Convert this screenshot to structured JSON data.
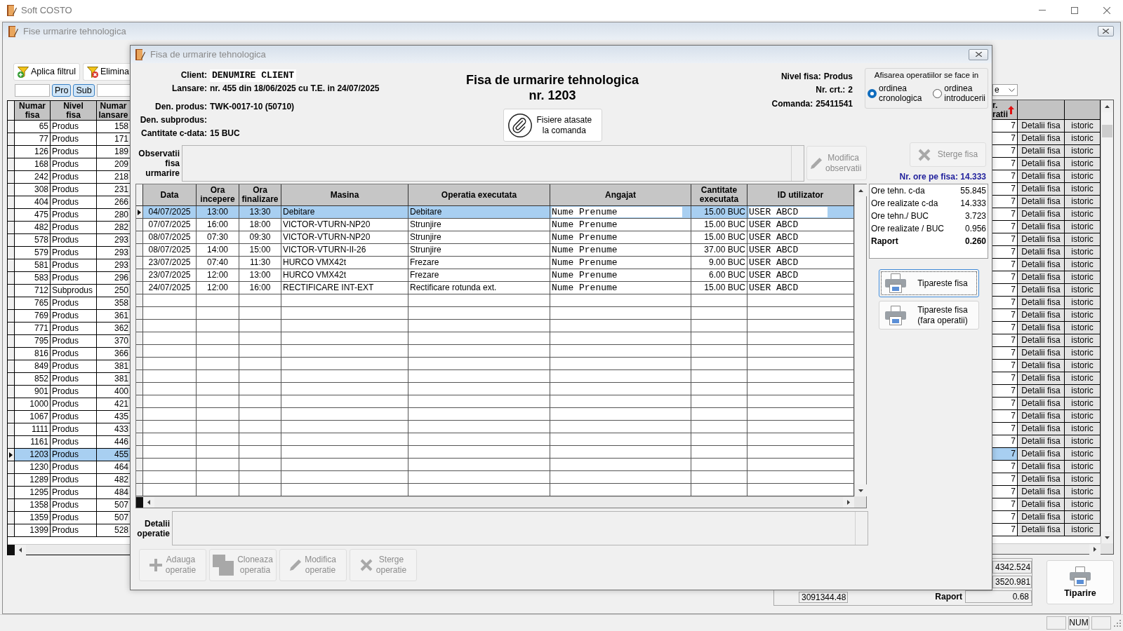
{
  "app_window": {
    "title": "Soft COSTO"
  },
  "child_window": {
    "title": "Fise urmarire tehnologica"
  },
  "filter_toolbar": [
    {
      "kind": "apply",
      "label": "Aplica filtrul"
    },
    {
      "kind": "remove",
      "label": "Elimina"
    }
  ],
  "filter_toggles": [
    {
      "label": "Pro",
      "selected": true
    },
    {
      "label": "Sub",
      "selected": true
    }
  ],
  "column_filter": {
    "value": "e"
  },
  "sheets_table": {
    "columns": [
      "Numar\nfisa",
      "Nivel\nfisa",
      "Numar\nlansare"
    ],
    "column_4": {
      "label": "r.\nratii",
      "sorted": true
    },
    "rows": [
      {
        "numar_fisa": "65",
        "nivel_fisa": "Produs",
        "numar_lansare": "158",
        "column_4": "7",
        "column_5": "Detalii fisa",
        "column_6": "istoric",
        "selected": false
      },
      {
        "numar_fisa": "77",
        "nivel_fisa": "Produs",
        "numar_lansare": "171",
        "column_4": "7",
        "column_5": "Detalii fisa",
        "column_6": "istoric",
        "selected": false
      },
      {
        "numar_fisa": "126",
        "nivel_fisa": "Produs",
        "numar_lansare": "189",
        "column_4": "7",
        "column_5": "Detalii fisa",
        "column_6": "istoric",
        "selected": false
      },
      {
        "numar_fisa": "168",
        "nivel_fisa": "Produs",
        "numar_lansare": "209",
        "column_4": "7",
        "column_5": "Detalii fisa",
        "column_6": "istoric",
        "selected": false
      },
      {
        "numar_fisa": "242",
        "nivel_fisa": "Produs",
        "numar_lansare": "218",
        "column_4": "7",
        "column_5": "Detalii fisa",
        "column_6": "istoric",
        "selected": false
      },
      {
        "numar_fisa": "308",
        "nivel_fisa": "Produs",
        "numar_lansare": "231",
        "column_4": "7",
        "column_5": "Detalii fisa",
        "column_6": "istoric",
        "selected": false
      },
      {
        "numar_fisa": "404",
        "nivel_fisa": "Produs",
        "numar_lansare": "266",
        "column_4": "7",
        "column_5": "Detalii fisa",
        "column_6": "istoric",
        "selected": false
      },
      {
        "numar_fisa": "475",
        "nivel_fisa": "Produs",
        "numar_lansare": "280",
        "column_4": "7",
        "column_5": "Detalii fisa",
        "column_6": "istoric",
        "selected": false
      },
      {
        "numar_fisa": "482",
        "nivel_fisa": "Produs",
        "numar_lansare": "282",
        "column_4": "7",
        "column_5": "Detalii fisa",
        "column_6": "istoric",
        "selected": false
      },
      {
        "numar_fisa": "578",
        "nivel_fisa": "Produs",
        "numar_lansare": "293",
        "column_4": "7",
        "column_5": "Detalii fisa",
        "column_6": "istoric",
        "selected": false
      },
      {
        "numar_fisa": "579",
        "nivel_fisa": "Produs",
        "numar_lansare": "293",
        "column_4": "7",
        "column_5": "Detalii fisa",
        "column_6": "istoric",
        "selected": false
      },
      {
        "numar_fisa": "581",
        "nivel_fisa": "Produs",
        "numar_lansare": "293",
        "column_4": "7",
        "column_5": "Detalii fisa",
        "column_6": "istoric",
        "selected": false
      },
      {
        "numar_fisa": "583",
        "nivel_fisa": "Produs",
        "numar_lansare": "296",
        "column_4": "7",
        "column_5": "Detalii fisa",
        "column_6": "istoric",
        "selected": false
      },
      {
        "numar_fisa": "712",
        "nivel_fisa": "Subprodus",
        "numar_lansare": "250",
        "column_4": "7",
        "column_5": "Detalii fisa",
        "column_6": "istoric",
        "selected": false
      },
      {
        "numar_fisa": "765",
        "nivel_fisa": "Produs",
        "numar_lansare": "358",
        "column_4": "7",
        "column_5": "Detalii fisa",
        "column_6": "istoric",
        "selected": false
      },
      {
        "numar_fisa": "769",
        "nivel_fisa": "Produs",
        "numar_lansare": "361",
        "column_4": "7",
        "column_5": "Detalii fisa",
        "column_6": "istoric",
        "selected": false
      },
      {
        "numar_fisa": "771",
        "nivel_fisa": "Produs",
        "numar_lansare": "362",
        "column_4": "7",
        "column_5": "Detalii fisa",
        "column_6": "istoric",
        "selected": false
      },
      {
        "numar_fisa": "795",
        "nivel_fisa": "Produs",
        "numar_lansare": "370",
        "column_4": "7",
        "column_5": "Detalii fisa",
        "column_6": "istoric",
        "selected": false
      },
      {
        "numar_fisa": "816",
        "nivel_fisa": "Produs",
        "numar_lansare": "366",
        "column_4": "7",
        "column_5": "Detalii fisa",
        "column_6": "istoric",
        "selected": false
      },
      {
        "numar_fisa": "849",
        "nivel_fisa": "Produs",
        "numar_lansare": "381",
        "column_4": "7",
        "column_5": "Detalii fisa",
        "column_6": "istoric",
        "selected": false
      },
      {
        "numar_fisa": "852",
        "nivel_fisa": "Produs",
        "numar_lansare": "381",
        "column_4": "7",
        "column_5": "Detalii fisa",
        "column_6": "istoric",
        "selected": false
      },
      {
        "numar_fisa": "901",
        "nivel_fisa": "Produs",
        "numar_lansare": "400",
        "column_4": "7",
        "column_5": "Detalii fisa",
        "column_6": "istoric",
        "selected": false
      },
      {
        "numar_fisa": "1000",
        "nivel_fisa": "Produs",
        "numar_lansare": "421",
        "column_4": "7",
        "column_5": "Detalii fisa",
        "column_6": "istoric",
        "selected": false
      },
      {
        "numar_fisa": "1067",
        "nivel_fisa": "Produs",
        "numar_lansare": "435",
        "column_4": "7",
        "column_5": "Detalii fisa",
        "column_6": "istoric",
        "selected": false
      },
      {
        "numar_fisa": "1111",
        "nivel_fisa": "Produs",
        "numar_lansare": "433",
        "column_4": "7",
        "column_5": "Detalii fisa",
        "column_6": "istoric",
        "selected": false
      },
      {
        "numar_fisa": "1161",
        "nivel_fisa": "Produs",
        "numar_lansare": "446",
        "column_4": "7",
        "column_5": "Detalii fisa",
        "column_6": "istoric",
        "selected": false
      },
      {
        "numar_fisa": "1203",
        "nivel_fisa": "Produs",
        "numar_lansare": "455",
        "column_4": "7",
        "column_5": "Detalii fisa",
        "column_6": "istoric",
        "selected": true
      },
      {
        "numar_fisa": "1230",
        "nivel_fisa": "Produs",
        "numar_lansare": "464",
        "column_4": "7",
        "column_5": "Detalii fisa",
        "column_6": "istoric",
        "selected": false
      },
      {
        "numar_fisa": "1289",
        "nivel_fisa": "Produs",
        "numar_lansare": "482",
        "column_4": "7",
        "column_5": "Detalii fisa",
        "column_6": "istoric",
        "selected": false
      },
      {
        "numar_fisa": "1295",
        "nivel_fisa": "Produs",
        "numar_lansare": "484",
        "column_4": "7",
        "column_5": "Detalii fisa",
        "column_6": "istoric",
        "selected": false
      },
      {
        "numar_fisa": "1358",
        "nivel_fisa": "Produs",
        "numar_lansare": "507",
        "column_4": "7",
        "column_5": "Detalii fisa",
        "column_6": "istoric",
        "selected": false
      },
      {
        "numar_fisa": "1359",
        "nivel_fisa": "Produs",
        "numar_lansare": "507",
        "column_4": "7",
        "column_5": "Detalii fisa",
        "column_6": "istoric",
        "selected": false
      },
      {
        "numar_fisa": "1399",
        "nivel_fisa": "Produs",
        "numar_lansare": "528",
        "column_4": "7",
        "column_5": "Detalii fisa",
        "column_6": "istoric",
        "selected": false
      }
    ]
  },
  "dialog": {
    "title": "Fisa de urmarire tehnologica",
    "client_fields": [
      {
        "label": "Client:",
        "value": "DENUMIRE CLIENT",
        "kind": "boxed"
      },
      {
        "label": "Lansare:",
        "value": "nr. 455 din 18/06/2025 cu T.E. in 24/07/2025",
        "kind": "plain"
      }
    ],
    "product_fields": [
      {
        "label": "Den. produs:",
        "value": "TWK-0017-10 (50710)",
        "kind": "plain"
      },
      {
        "label": "Den. subprodus:"
      },
      {
        "label": "Cantitate c-data:",
        "value": "15 BUC",
        "kind": "plain"
      }
    ],
    "heading": {
      "title": "Fisa de urmarire tehnologica",
      "number": "nr. 1203"
    },
    "attachments_button": {
      "label": "Fisiere atasate\nla comanda"
    },
    "info_right": [
      {
        "label": "Nivel fisa:",
        "value": "Produs"
      },
      {
        "label": "Nr. crt.:",
        "value": "2"
      },
      {
        "label": "Comanda:",
        "value": "25411541"
      }
    ],
    "order_group": {
      "title": "Afisarea operatiilor se face in",
      "options": [
        {
          "label": "ordinea\ncronologica",
          "selected": true
        },
        {
          "label": "ordinea\nintroducerii",
          "selected": false
        }
      ]
    },
    "notes": {
      "label": "Observatii\nfisa\nurmarire"
    },
    "edit_notes_button": {
      "label": "Modifica\nobservatii",
      "disabled": true
    },
    "delete_button": {
      "label": "Sterge fisa",
      "disabled": true
    },
    "hours_total": "Nr. ore pe fisa: 14.333",
    "operations": {
      "columns": [
        "Data",
        "Ora\nincepere",
        "Ora\nfinalizare",
        "Masina",
        "Operatia executata",
        "Angajat",
        "Cantitate\nexecutata",
        "ID utilizator"
      ],
      "rows": [
        {
          "date": "04/07/2025",
          "start_time": "13:00",
          "end_time": "13:30",
          "machine": "Debitare",
          "operation": "Debitare",
          "employee": "Nume Prenume",
          "quantity": "15.00 BUC",
          "user_id": "USER ABCD",
          "selected": true
        },
        {
          "date": "07/07/2025",
          "start_time": "16:00",
          "end_time": "18:00",
          "machine": "VICTOR-VTURN-NP20",
          "operation": "Strunjire",
          "employee": "Nume Prenume",
          "quantity": "15.00 BUC",
          "user_id": "USER ABCD",
          "selected": false
        },
        {
          "date": "08/07/2025",
          "start_time": "07:30",
          "end_time": "09:30",
          "machine": "VICTOR-VTURN-NP20",
          "operation": "Strunjire",
          "employee": "Nume Prenume",
          "quantity": "15.00 BUC",
          "user_id": "USER ABCD",
          "selected": false
        },
        {
          "date": "08/07/2025",
          "start_time": "14:00",
          "end_time": "15:00",
          "machine": "VICTOR-VTURN-II-26",
          "operation": "Strunjire",
          "employee": "Nume Prenume",
          "quantity": "37.00 BUC",
          "user_id": "USER ABCD",
          "selected": false
        },
        {
          "date": "23/07/2025",
          "start_time": "07:40",
          "end_time": "11:30",
          "machine": "HURCO VMX42t",
          "operation": "Frezare",
          "employee": "Nume Prenume",
          "quantity": "9.00 BUC",
          "user_id": "USER ABCD",
          "selected": false
        },
        {
          "date": "23/07/2025",
          "start_time": "12:00",
          "end_time": "13:00",
          "machine": "HURCO VMX42t",
          "operation": "Frezare",
          "employee": "Nume Prenume",
          "quantity": "6.00 BUC",
          "user_id": "USER ABCD",
          "selected": false
        },
        {
          "date": "24/07/2025",
          "start_time": "12:00",
          "end_time": "16:00",
          "machine": "RECTIFICARE INT-EXT",
          "operation": "Rectificare rotunda ext.",
          "employee": "Nume Prenume",
          "quantity": "15.00 BUC",
          "user_id": "USER ABCD",
          "selected": false
        }
      ]
    },
    "stats": [
      {
        "label": "Ore tehn. c-da",
        "value": "55.845",
        "kind": "normal"
      },
      {
        "label": "Ore realizate c-da",
        "value": "14.333",
        "kind": "normal"
      },
      {
        "label": "Ore tehn./ BUC",
        "value": "3.723",
        "kind": "normal"
      },
      {
        "label": "Ore realizate / BUC",
        "value": "0.956",
        "kind": "normal"
      },
      {
        "label": "Raport",
        "value": "0.260",
        "kind": "total"
      }
    ],
    "print_buttons": [
      {
        "label": "Tipareste fisa",
        "focused": true
      },
      {
        "label": "Tipareste fisa\n(fara operatii)",
        "focused": false
      }
    ],
    "details": {
      "label": "Detalii\noperatie"
    },
    "actions": [
      {
        "kind": "add",
        "label": "Adauga\noperatie",
        "disabled": true
      },
      {
        "kind": "clone",
        "label": "Cloneaza\noperatia",
        "disabled": true
      },
      {
        "kind": "edit",
        "label": "Modifica\noperatie",
        "disabled": true
      },
      {
        "kind": "delete",
        "label": "Sterge\noperatie",
        "disabled": true
      }
    ]
  },
  "totals": {
    "field_1": "4342.524",
    "field_2": "3520.981",
    "field_3": "3091344.48",
    "ratio_label": "Raport",
    "ratio_value": "0.68"
  },
  "print_button": {
    "label": "Tiparire"
  },
  "status_bar": {
    "panels": [
      {
        "kind": "blank"
      },
      {
        "kind": "text",
        "text": "NUM"
      },
      {
        "kind": "blank"
      }
    ]
  }
}
